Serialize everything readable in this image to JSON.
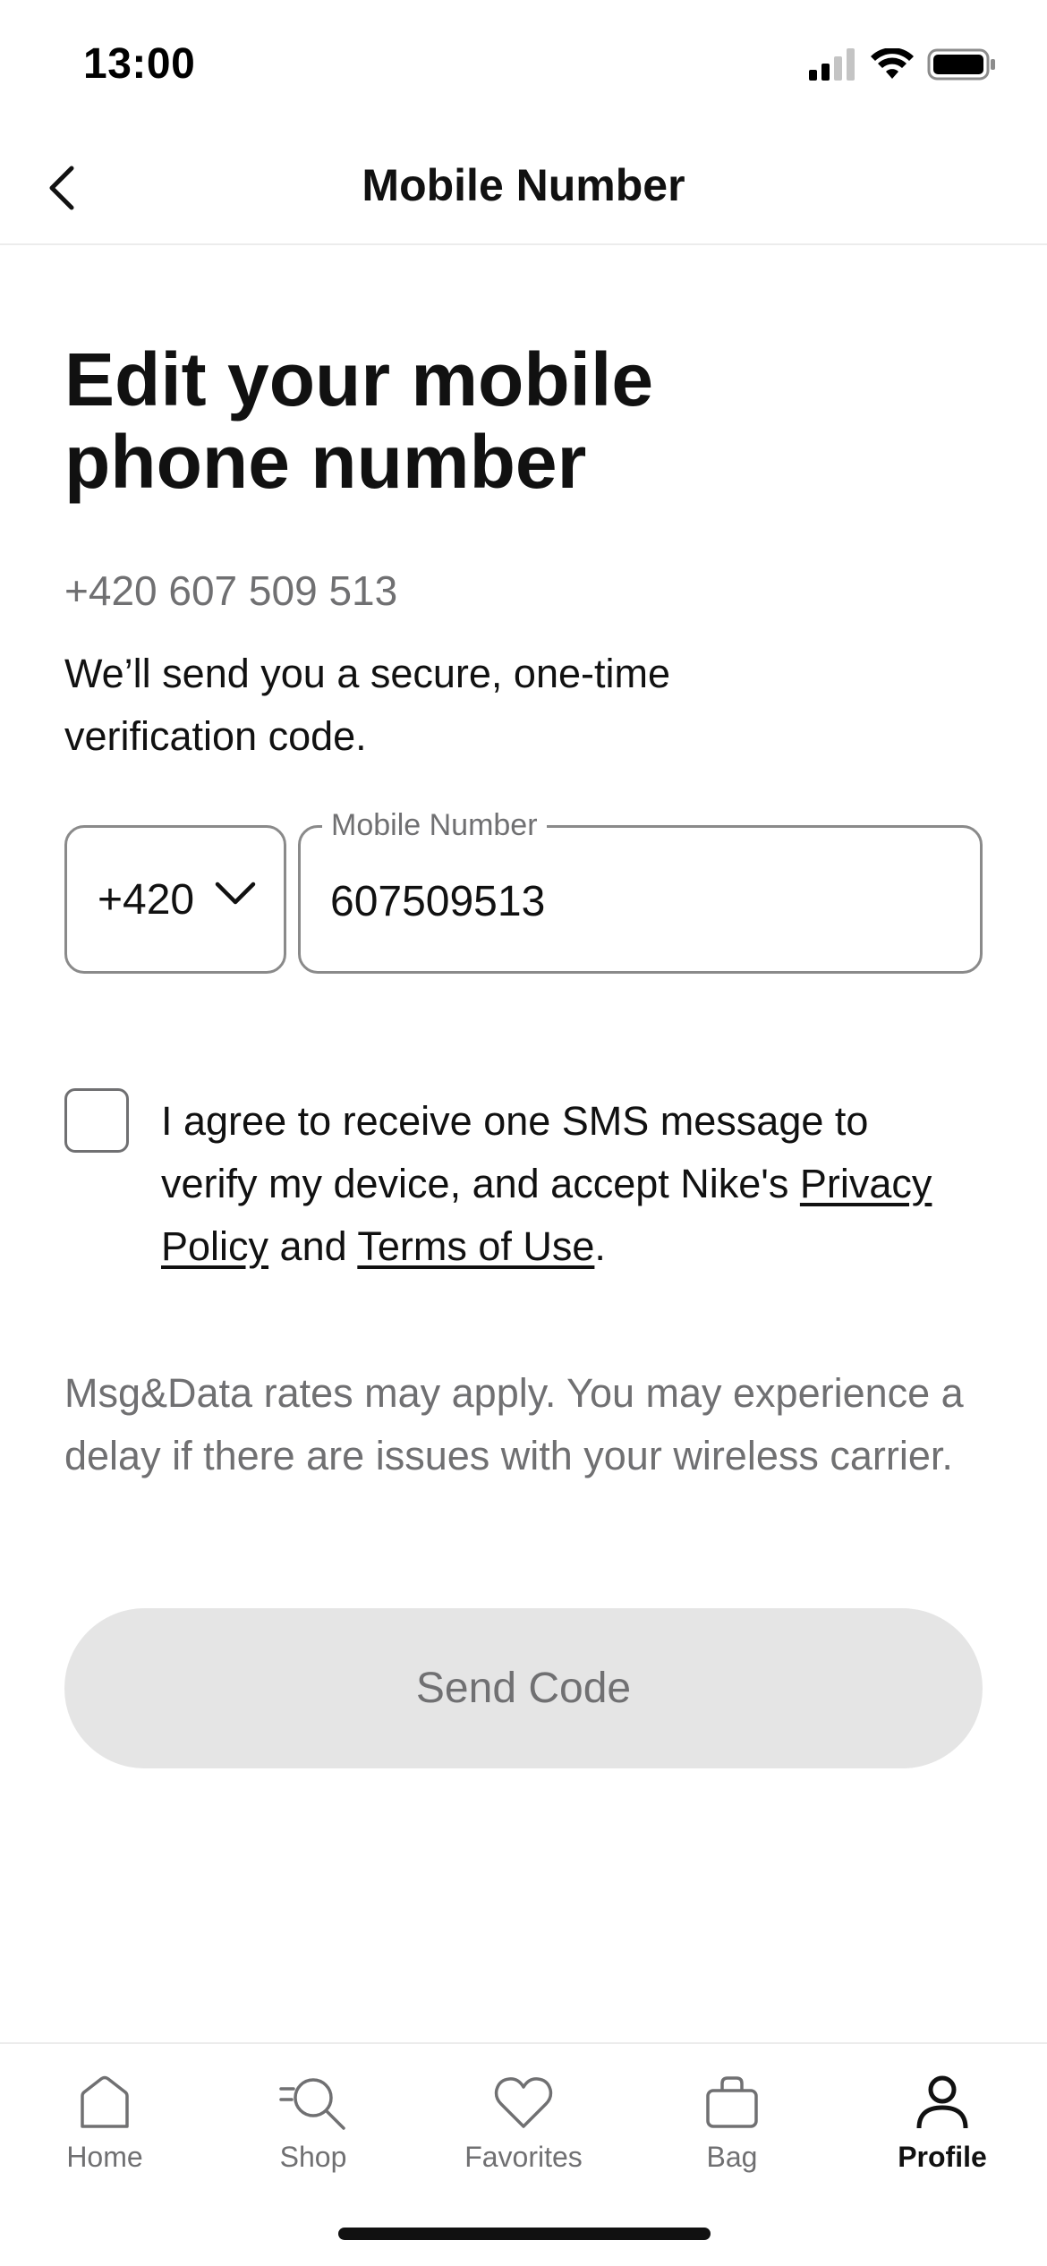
{
  "status_bar": {
    "time": "13:00"
  },
  "header": {
    "title": "Mobile Number",
    "back_icon": "chevron-left-icon"
  },
  "main": {
    "title": "Edit your mobile phone number",
    "current_number": "+420 607 509 513",
    "description": "We’ll send you a secure, one-time verification code.",
    "country_code": {
      "value": "+420",
      "icon": "chevron-down-icon"
    },
    "phone_field": {
      "label": "Mobile Number",
      "value": "607509513"
    },
    "consent": {
      "checked": false,
      "text_before": "I agree to receive one SMS message to verify my device, and accept Nike's ",
      "privacy_link": "Privacy Policy",
      "and": " and ",
      "terms_link": "Terms of Use",
      "period": "."
    },
    "disclaimer": "Msg&Data rates may apply. You may experience a delay if there are issues with your wireless carrier.",
    "send_button": "Send Code"
  },
  "tab_bar": {
    "items": [
      {
        "label": "Home",
        "icon": "home-icon",
        "active": false
      },
      {
        "label": "Shop",
        "icon": "search-icon",
        "active": false
      },
      {
        "label": "Favorites",
        "icon": "heart-icon",
        "active": false
      },
      {
        "label": "Bag",
        "icon": "bag-icon",
        "active": false
      },
      {
        "label": "Profile",
        "icon": "profile-icon",
        "active": true
      }
    ]
  },
  "colors": {
    "text": "#111111",
    "muted": "#707072",
    "button_disabled": "#e5e5e5",
    "border": "#8a8a8a"
  }
}
